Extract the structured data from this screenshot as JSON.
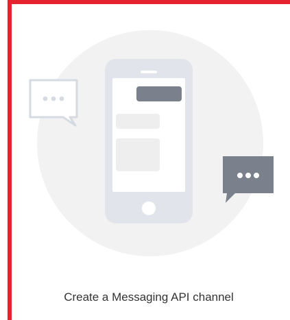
{
  "card": {
    "title": "Create a Messaging API channel",
    "accent_color": "#e5222e"
  },
  "illustration": {
    "icons": [
      "smartphone-icon",
      "chat-bubble-outline-icon",
      "chat-bubble-filled-icon"
    ],
    "bubble_dark_color": "#7a818d",
    "phone_color": "#e1e4ea",
    "background_circle_color": "#f2f2f2"
  }
}
